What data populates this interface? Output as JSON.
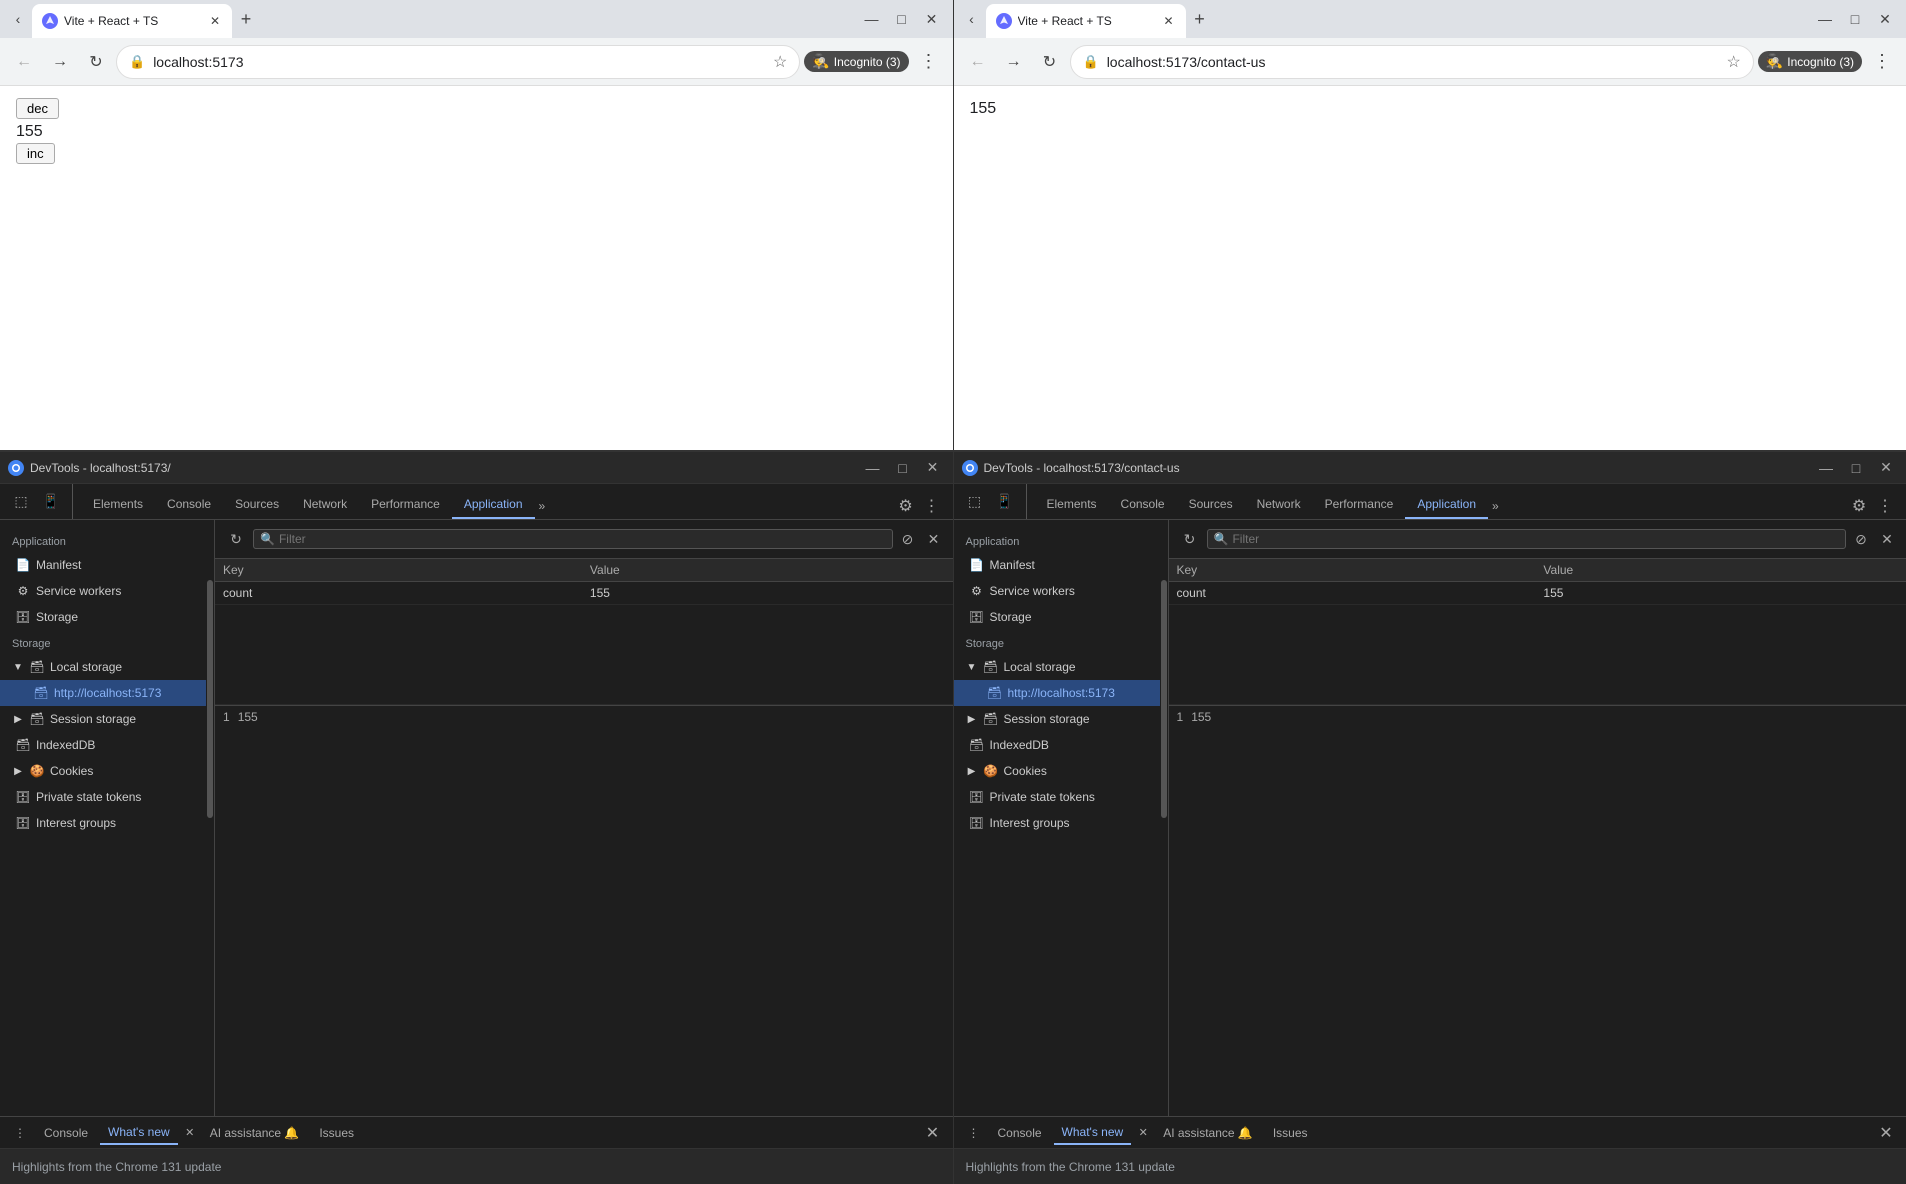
{
  "browser1": {
    "tab_title": "Vite + React + TS",
    "url": "localhost:5173",
    "incognito_label": "Incognito (3)",
    "dec_btn": "dec",
    "counter_value": "155",
    "inc_btn": "inc"
  },
  "browser2": {
    "tab_title": "Vite + React + TS",
    "url": "localhost:5173/contact-us",
    "incognito_label": "Incognito (3)",
    "counter_value": "155"
  },
  "devtools1": {
    "title": "DevTools - localhost:5173/",
    "tabs": [
      "Elements",
      "Console",
      "Sources",
      "Network",
      "Performance",
      "Application"
    ],
    "active_tab": "Application",
    "sidebar": {
      "app_label": "Application",
      "items": [
        {
          "label": "Manifest",
          "icon": "📄",
          "indent": 0
        },
        {
          "label": "Service workers",
          "icon": "⚙",
          "indent": 0
        },
        {
          "label": "Storage",
          "icon": "🗄",
          "indent": 0
        }
      ],
      "storage_label": "Storage",
      "storage_items": [
        {
          "label": "Local storage",
          "icon": "🗃",
          "expanded": true,
          "indent": 0
        },
        {
          "label": "http://localhost:5173",
          "icon": "🗃",
          "indent": 1,
          "selected": true
        },
        {
          "label": "Session storage",
          "icon": "🗃",
          "expanded": false,
          "indent": 0
        },
        {
          "label": "IndexedDB",
          "icon": "🗃",
          "expanded": false,
          "indent": 0
        },
        {
          "label": "Cookies",
          "icon": "🍪",
          "expanded": false,
          "indent": 0
        },
        {
          "label": "Private state tokens",
          "icon": "🗄",
          "indent": 0
        },
        {
          "label": "Interest groups",
          "icon": "🗄",
          "indent": 0
        }
      ]
    },
    "filter_placeholder": "Filter",
    "table": {
      "headers": [
        "Key",
        "Value"
      ],
      "rows": [
        {
          "key": "count",
          "value": "155"
        }
      ],
      "footer_row": "1",
      "footer_value": "155"
    }
  },
  "devtools2": {
    "title": "DevTools - localhost:5173/contact-us",
    "tabs": [
      "Elements",
      "Console",
      "Sources",
      "Network",
      "Performance",
      "Application"
    ],
    "active_tab": "Application",
    "sidebar": {
      "app_label": "Application",
      "items": [
        {
          "label": "Manifest",
          "icon": "📄",
          "indent": 0
        },
        {
          "label": "Service workers",
          "icon": "⚙",
          "indent": 0
        },
        {
          "label": "Storage",
          "icon": "🗄",
          "indent": 0
        }
      ],
      "storage_label": "Storage",
      "storage_items": [
        {
          "label": "Local storage",
          "icon": "🗃",
          "expanded": true,
          "indent": 0
        },
        {
          "label": "http://localhost:5173",
          "icon": "🗃",
          "indent": 1,
          "selected": true
        },
        {
          "label": "Session storage",
          "icon": "🗃",
          "expanded": false,
          "indent": 0
        },
        {
          "label": "IndexedDB",
          "icon": "🗃",
          "expanded": false,
          "indent": 0
        },
        {
          "label": "Cookies",
          "icon": "🍪",
          "expanded": false,
          "indent": 0
        },
        {
          "label": "Private state tokens",
          "icon": "🗄",
          "indent": 0
        },
        {
          "label": "Interest groups",
          "icon": "🗄",
          "indent": 0
        }
      ]
    },
    "filter_placeholder": "Filter",
    "table": {
      "headers": [
        "Key",
        "Value"
      ],
      "rows": [
        {
          "key": "count",
          "value": "155"
        }
      ],
      "footer_row": "1",
      "footer_value": "155"
    }
  },
  "bottom_tabs1": {
    "console_label": "Console",
    "whats_new_label": "What's new",
    "ai_label": "AI assistance",
    "issues_label": "Issues",
    "highlights_text": "Highlights from the Chrome 131 update"
  },
  "bottom_tabs2": {
    "console_label": "Console",
    "whats_new_label": "What's new",
    "ai_label": "AI assistance",
    "issues_label": "Issues",
    "highlights_text": "Highlights from the Chrome 131 update"
  },
  "colors": {
    "accent_blue": "#8ab4f8",
    "selected_bg": "#2a4a7f",
    "devtools_bg": "#1e1e1e",
    "devtools_border": "#444"
  }
}
